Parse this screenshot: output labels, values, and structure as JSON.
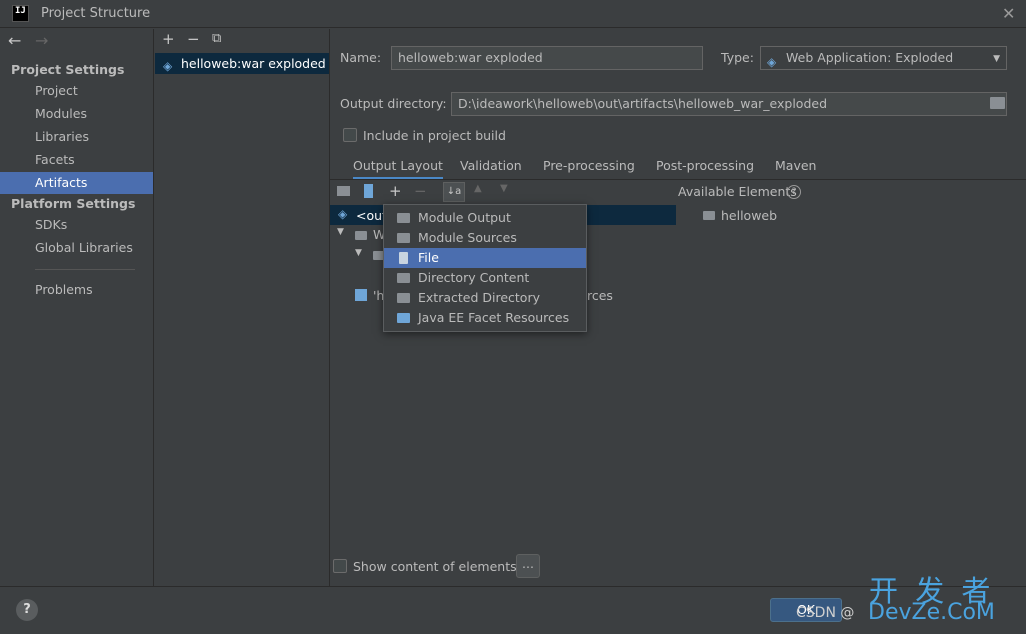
{
  "window": {
    "title": "Project Structure",
    "logo": "IJ"
  },
  "nav": {
    "project_settings": "Project Settings",
    "project_items": [
      "Project",
      "Modules",
      "Libraries",
      "Facets",
      "Artifacts"
    ],
    "platform_settings": "Platform Settings",
    "platform_items": [
      "SDKs",
      "Global Libraries"
    ],
    "problems": "Problems",
    "selected": "Artifacts"
  },
  "artifacts": {
    "items": [
      "helloweb:war exploded"
    ]
  },
  "form": {
    "name_label": "Name:",
    "name_value": "helloweb:war exploded",
    "type_label": "Type:",
    "type_value": "Web Application: Exploded",
    "output_dir_label": "Output directory:",
    "output_dir_value": "D:\\ideawork\\helloweb\\out\\artifacts\\helloweb_war_exploded",
    "include_in_build": "Include in project build"
  },
  "tabs": [
    "Output Layout",
    "Validation",
    "Pre-processing",
    "Post-processing",
    "Maven"
  ],
  "tree": {
    "row1": "<out",
    "row2": "W",
    "row4_prefix": "'h",
    "row4_suffix": "rces"
  },
  "popup": {
    "items": [
      "Module Output",
      "Module Sources",
      "File",
      "Directory Content",
      "Extracted Directory",
      "Java EE Facet Resources"
    ],
    "selected": "File"
  },
  "available": {
    "label": "Available Elements",
    "items": [
      "helloweb"
    ]
  },
  "bottom": {
    "show_content": "Show content of elements",
    "more": "...",
    "ok": "OK",
    "help": "?",
    "csdn": "CSDN @",
    "watermark": "开 发 者",
    "watermark_sub": "DevZe.CoM"
  }
}
